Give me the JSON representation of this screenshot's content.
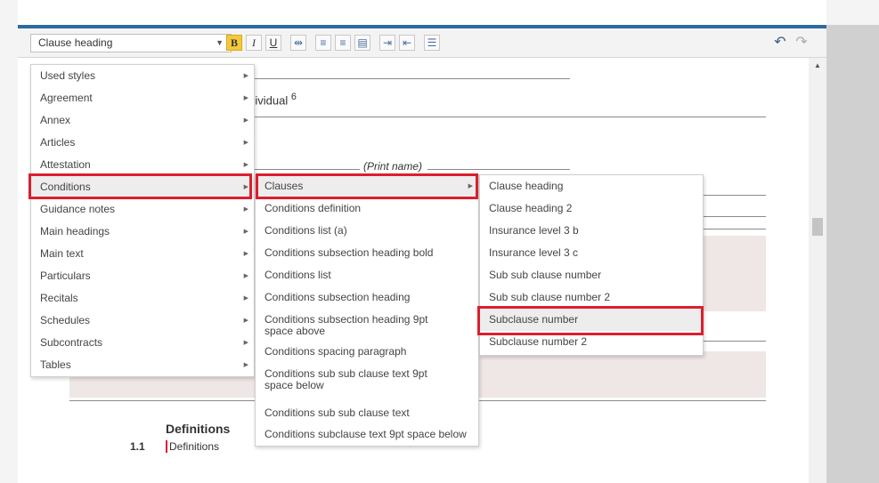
{
  "toolbar": {
    "style_select_value": "Clause heading",
    "bold_label": "B",
    "italic_label": "I",
    "underline_label": "U",
    "icons": [
      "bold-icon",
      "italic-icon",
      "underline-icon",
      "format-icon",
      "align-left-icon",
      "align-center-icon",
      "align-justify-icon",
      "indent-icon",
      "outdent-icon",
      "list-icon",
      "undo-icon",
      "redo-icon"
    ]
  },
  "document": {
    "individual_label": "individual",
    "superscript": "6",
    "print_name_label": "(Print name)",
    "definitions_heading": "Definitions",
    "clause_number": "1.1",
    "clause_text": "Definitions"
  },
  "menus": {
    "level1": [
      {
        "label": "Used styles"
      },
      {
        "label": "Agreement"
      },
      {
        "label": "Annex"
      },
      {
        "label": "Articles"
      },
      {
        "label": "Attestation"
      },
      {
        "label": "Conditions"
      },
      {
        "label": "Guidance notes"
      },
      {
        "label": "Main headings"
      },
      {
        "label": "Main text"
      },
      {
        "label": "Particulars"
      },
      {
        "label": "Recitals"
      },
      {
        "label": "Schedules"
      },
      {
        "label": "Subcontracts"
      },
      {
        "label": "Tables"
      }
    ],
    "level2": [
      {
        "label": "Clauses"
      },
      {
        "label": "Conditions definition"
      },
      {
        "label": "Conditions list (a)"
      },
      {
        "label": "Conditions subsection heading bold"
      },
      {
        "label": "Conditions list"
      },
      {
        "label": "Conditions subsection heading"
      },
      {
        "label": "Conditions subsection heading 9pt space above"
      },
      {
        "label": "Conditions spacing paragraph"
      },
      {
        "label": "Conditions sub sub clause text 9pt space below"
      },
      {
        "label": "Conditions sub sub clause text"
      },
      {
        "label": "Conditions subclause text 9pt space below"
      }
    ],
    "level3": [
      {
        "label": "Clause heading"
      },
      {
        "label": "Clause heading 2"
      },
      {
        "label": "Insurance level 3 b"
      },
      {
        "label": "Insurance level 3 c"
      },
      {
        "label": "Sub sub clause number"
      },
      {
        "label": "Sub sub clause number 2"
      },
      {
        "label": "Subclause number"
      },
      {
        "label": "Subclause number 2"
      }
    ]
  },
  "colors": {
    "highlight_red": "#dc1e2e",
    "accent_blue": "#2c6aa0",
    "bold_active": "#f5c73a"
  }
}
